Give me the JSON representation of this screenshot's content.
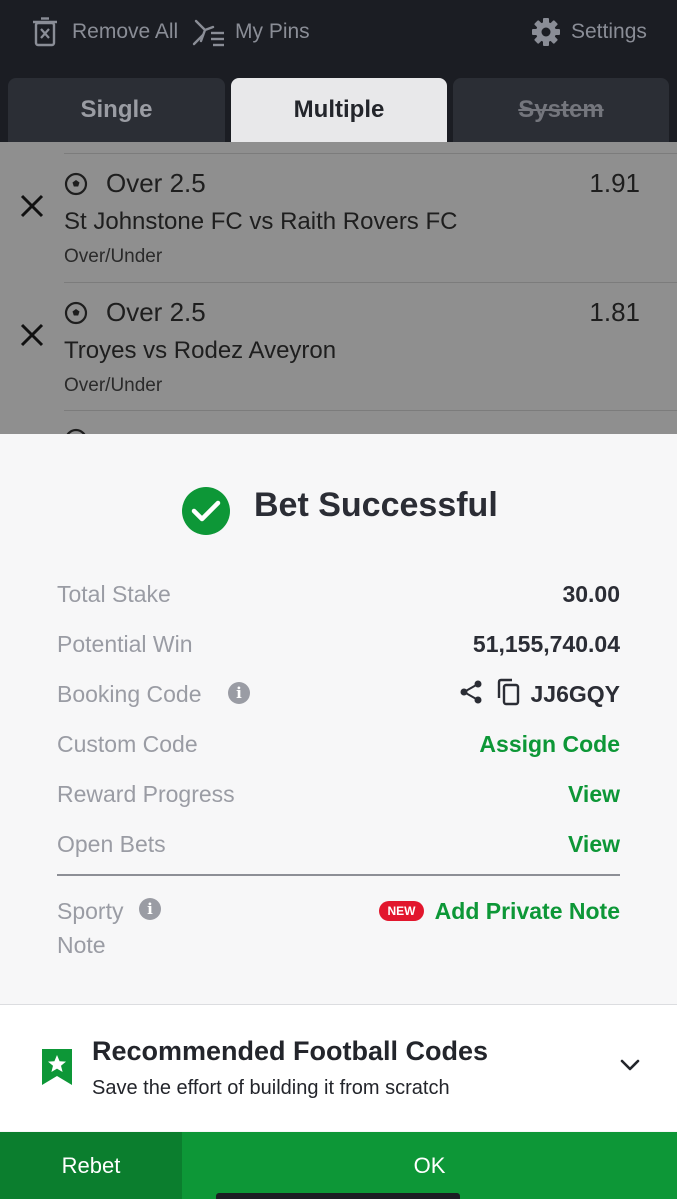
{
  "toolbar": {
    "remove_all": "Remove All",
    "my_pins": "My Pins",
    "settings": "Settings",
    "icons": [
      "trash-x-icon",
      "pins-icon",
      "gear-icon"
    ]
  },
  "tabs": [
    {
      "label": "Single",
      "active": false
    },
    {
      "label": "Multiple",
      "active": true
    },
    {
      "label": "System",
      "active": false,
      "disabled": true
    }
  ],
  "selections": [
    {
      "pick": "Over 2.5",
      "odds": "1.91",
      "match": "St Johnstone FC vs Raith Rovers FC",
      "market": "Over/Under"
    },
    {
      "pick": "Over 2.5",
      "odds": "1.81",
      "match": "Troyes vs Rodez Aveyron",
      "market": "Over/Under"
    }
  ],
  "result": {
    "title": "Bet Successful",
    "total_stake_label": "Total Stake",
    "total_stake": "30.00",
    "potential_win_label": "Potential Win",
    "potential_win": "51,155,740.04",
    "booking_code_label": "Booking Code",
    "booking_code": "JJ6GQY",
    "custom_code_label": "Custom Code",
    "custom_code_action": "Assign Code",
    "reward_progress_label": "Reward Progress",
    "reward_progress_action": "View",
    "open_bets_label": "Open Bets",
    "open_bets_action": "View",
    "note_label_line1": "Sporty",
    "note_label_line2": "Note",
    "new_badge": "NEW",
    "note_action": "Add Private Note"
  },
  "recommended": {
    "title": "Recommended Football Codes",
    "subtitle": "Save the effort of building it from scratch"
  },
  "buttons": {
    "rebet": "Rebet",
    "ok": "OK"
  },
  "colors": {
    "accent_green": "#0d9737",
    "dark_green": "#0b7e2e",
    "toolbar_bg": "#1b1d23",
    "badge_red": "#e2162d"
  }
}
